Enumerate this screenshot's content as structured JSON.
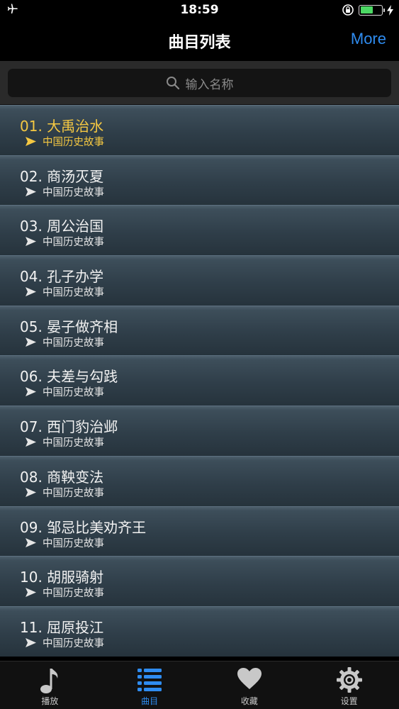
{
  "status_bar": {
    "time": "18:59"
  },
  "nav": {
    "title": "曲目列表",
    "more_label": "More"
  },
  "search": {
    "placeholder": "输入名称"
  },
  "tracks": [
    {
      "title": "01. 大禹治水",
      "subtitle": "中国历史故事"
    },
    {
      "title": "02. 商汤灭夏",
      "subtitle": "中国历史故事"
    },
    {
      "title": "03. 周公治国",
      "subtitle": "中国历史故事"
    },
    {
      "title": "04. 孔子办学",
      "subtitle": "中国历史故事"
    },
    {
      "title": "05. 晏子做齐相",
      "subtitle": "中国历史故事"
    },
    {
      "title": "06. 夫差与勾践",
      "subtitle": "中国历史故事"
    },
    {
      "title": "07. 西门豹治邺",
      "subtitle": "中国历史故事"
    },
    {
      "title": "08. 商鞅变法",
      "subtitle": "中国历史故事"
    },
    {
      "title": "09. 邹忌比美劝齐王",
      "subtitle": "中国历史故事"
    },
    {
      "title": "10. 胡服骑射",
      "subtitle": "中国历史故事"
    },
    {
      "title": "11. 屈原投江",
      "subtitle": "中国历史故事"
    }
  ],
  "active_track_index": 0,
  "tabs": [
    {
      "label": "播放",
      "icon": "music-note-icon"
    },
    {
      "label": "曲目",
      "icon": "list-icon"
    },
    {
      "label": "收藏",
      "icon": "heart-icon"
    },
    {
      "label": "设置",
      "icon": "gear-icon"
    }
  ],
  "active_tab_index": 1,
  "colors": {
    "accent": "#2f8cf0",
    "active_track": "#f5c842",
    "battery": "#4cd964"
  }
}
